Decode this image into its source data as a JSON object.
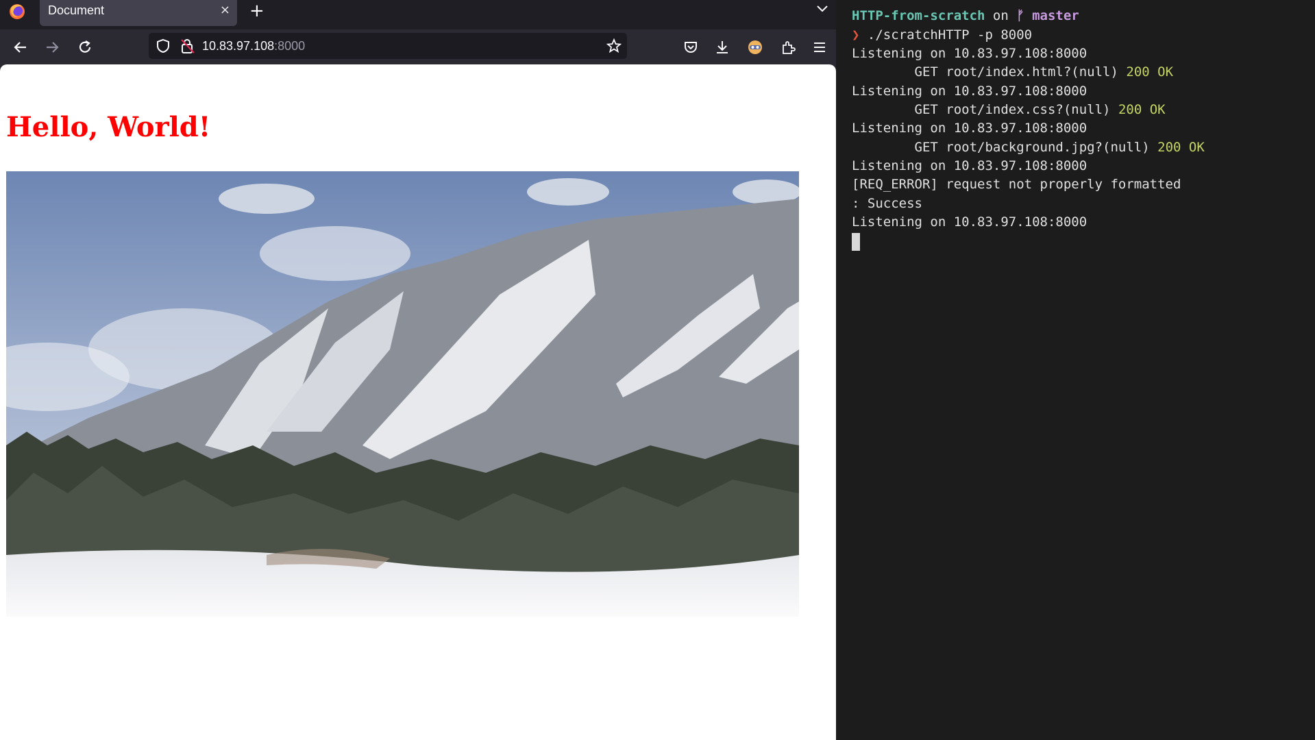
{
  "browser": {
    "tab": {
      "title": "Document",
      "close_glyph": "×"
    },
    "new_tab_glyph": "+",
    "url": {
      "host": "10.83.97.108",
      "port": ":8000"
    },
    "page": {
      "heading": "Hello, World!",
      "heading_color": "#ff0000"
    },
    "icons": [
      "firefox-logo",
      "back-arrow-icon",
      "forward-arrow-icon",
      "reload-icon",
      "shield-icon",
      "lock-warning-icon",
      "star-icon",
      "pocket-icon",
      "download-icon",
      "account-avatar-icon",
      "extensions-icon",
      "hamburger-menu-icon",
      "chevron-down-icon"
    ]
  },
  "terminal": {
    "prompt": {
      "dir": "HTTP-from-scratch",
      "on": " on ",
      "branch_icon": "ᚠ",
      "branch": " master",
      "arrow": "❯",
      "command": " ./scratchHTTP -p 8000"
    },
    "lines": [
      {
        "text": "Listening on 10.83.97.108:8000"
      },
      {
        "text": "        GET root/index.html?(null) ",
        "status": "200 OK"
      },
      {
        "text": "Listening on 10.83.97.108:8000"
      },
      {
        "text": "        GET root/index.css?(null) ",
        "status": "200 OK"
      },
      {
        "text": "Listening on 10.83.97.108:8000"
      },
      {
        "text": "        GET root/background.jpg?(null) ",
        "status": "200 OK"
      },
      {
        "text": "Listening on 10.83.97.108:8000"
      },
      {
        "text": "[REQ_ERROR] request not properly formatted"
      },
      {
        "text": ": Success"
      },
      {
        "text": "Listening on 10.83.97.108:8000"
      }
    ],
    "colors": {
      "dir": "#68c8b4",
      "branch": "#c99be0",
      "status_ok": "#c5d462",
      "arrow": "#e5533b"
    }
  }
}
